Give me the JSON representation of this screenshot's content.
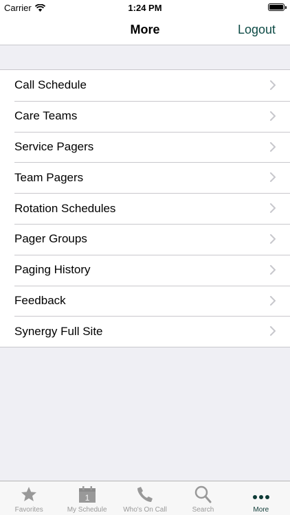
{
  "status_bar": {
    "carrier": "Carrier",
    "time": "1:24 PM"
  },
  "nav": {
    "title": "More",
    "logout_label": "Logout"
  },
  "menu": [
    {
      "label": "Call Schedule",
      "name": "call-schedule"
    },
    {
      "label": "Care Teams",
      "name": "care-teams"
    },
    {
      "label": "Service Pagers",
      "name": "service-pagers"
    },
    {
      "label": "Team Pagers",
      "name": "team-pagers"
    },
    {
      "label": "Rotation Schedules",
      "name": "rotation-schedules"
    },
    {
      "label": "Pager Groups",
      "name": "pager-groups"
    },
    {
      "label": "Paging History",
      "name": "paging-history"
    },
    {
      "label": "Feedback",
      "name": "feedback"
    },
    {
      "label": "Synergy Full Site",
      "name": "synergy-full-site"
    }
  ],
  "tabs": [
    {
      "label": "Favorites",
      "name": "favorites",
      "icon": "star-icon"
    },
    {
      "label": "My Schedule",
      "name": "my-schedule",
      "icon": "calendar-icon",
      "icon_text": "1"
    },
    {
      "label": "Who's On Call",
      "name": "whos-on-call",
      "icon": "phone-icon"
    },
    {
      "label": "Search",
      "name": "search",
      "icon": "search-icon"
    },
    {
      "label": "More",
      "name": "more",
      "icon": "more-icon",
      "active": true
    }
  ],
  "colors": {
    "accent": "#0d4a45",
    "inactive_tab": "#999999",
    "background": "#efeff4"
  }
}
